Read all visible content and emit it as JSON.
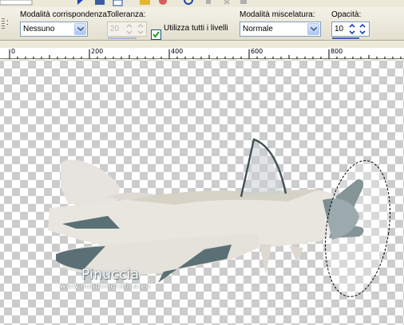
{
  "toolbar": {
    "icons": [
      "arrow-icon",
      "spray-icon",
      "layers-icon",
      "open-folder-icon",
      "stop-icon",
      "refresh-icon",
      "pause-icon",
      "close-icon",
      "menu-icon"
    ]
  },
  "options": {
    "modalita_corrispondenza": {
      "label": "Modalità corrispondenza:",
      "value": "Nessuno"
    },
    "tolleranza": {
      "label": "Tolleranza:",
      "value": "20",
      "disabled": true
    },
    "utilizza_tutti_livelli": {
      "label": "Utilizza tutti i livelli",
      "checked": true
    },
    "modalita_miscelatura": {
      "label": "Modalità miscelatura:",
      "value": "Normale"
    },
    "opacita": {
      "label": "Opacità:",
      "value": "10"
    }
  },
  "ruler": {
    "labels": [
      "0",
      "200",
      "400",
      "600",
      "800"
    ]
  },
  "watermark": {
    "name": "Pinuccia",
    "url": "www.maidiregrafica.eu"
  },
  "colors": {
    "accent": "#3e63b9",
    "plane_body": "#e9e7e2",
    "plane_dark": "#5b7074"
  }
}
